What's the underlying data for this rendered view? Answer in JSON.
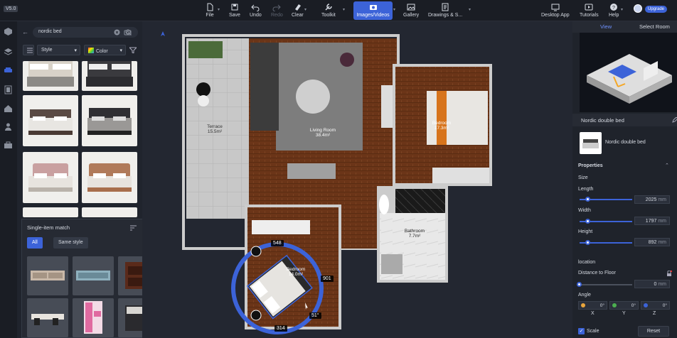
{
  "topbar": {
    "version": "V5.0",
    "items": [
      {
        "label": "File",
        "icon": "file-icon"
      },
      {
        "label": "Save",
        "icon": "save-icon"
      },
      {
        "label": "Undo",
        "icon": "undo-icon"
      },
      {
        "label": "Redo",
        "icon": "redo-icon"
      },
      {
        "label": "Clear",
        "icon": "clear-icon"
      },
      {
        "label": "Toolkit",
        "icon": "toolkit-icon"
      },
      {
        "label": "Images/Videos",
        "icon": "camera-icon"
      },
      {
        "label": "Gallery",
        "icon": "gallery-icon"
      },
      {
        "label": "Drawings & S...",
        "icon": "drawings-icon"
      },
      {
        "label": "Desktop App",
        "icon": "desktop-icon"
      },
      {
        "label": "Tutorials",
        "icon": "tutorials-icon"
      },
      {
        "label": "Help",
        "icon": "help-icon"
      }
    ],
    "upgrade_label": "Upgrade"
  },
  "left_panel": {
    "search_value": "nordic bed",
    "filter_style": "Style",
    "filter_color": "Color"
  },
  "single_item_match": {
    "title": "Single-item match",
    "tab_all": "All",
    "tab_same_style": "Same style"
  },
  "floorplan": {
    "rooms": [
      {
        "name": "Terrace",
        "area": "15.5m²"
      },
      {
        "name": "Living Room",
        "area": "38.4m²"
      },
      {
        "name": "Bedroom",
        "area": "17.3m²"
      },
      {
        "name": "Bathroom",
        "area": "7.7m²"
      },
      {
        "name": "Bedroom",
        "area": "14.0m²"
      }
    ],
    "dimension_top": "548",
    "dimension_right": "901",
    "dimension_bottom": "314",
    "rotation": "51°"
  },
  "right_panel": {
    "tab_view": "View",
    "tab_select_room": "Select Room",
    "object_title": "Nordic double bed",
    "object_name": "Nordic double bed",
    "properties_label": "Properties",
    "size_label": "Size",
    "length_label": "Length",
    "length_value": "2025",
    "width_label": "Width",
    "width_value": "1797",
    "height_label": "Height",
    "height_value": "892",
    "unit": "mm",
    "location_label": "location",
    "distance_label": "Distance to Floor",
    "distance_value": "0",
    "angle_label": "Angle",
    "angle_x": "0°",
    "angle_y": "0°",
    "angle_z": "0°",
    "axis_x": "X",
    "axis_y": "Y",
    "axis_z": "Z",
    "scale_label": "Scale",
    "reset_label": "Reset"
  },
  "colors": {
    "accent": "#3c63d8",
    "floor_wood": "#6b3518",
    "rug": "#7d7d7d"
  }
}
